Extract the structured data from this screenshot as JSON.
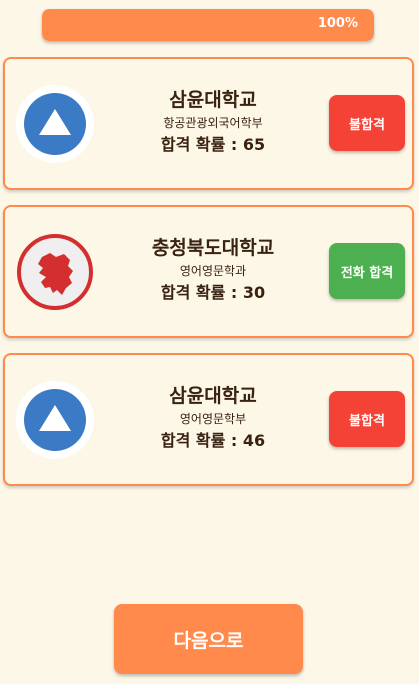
{
  "progress": {
    "value": 1.0,
    "label": "100%"
  },
  "colors": {
    "accent": "#ff8a4c",
    "fail": "#f44336",
    "phone_pass": "#4caf50",
    "background": "#fdf7e8"
  },
  "cards": [
    {
      "name": "삼윤대학교",
      "dept": "항공관광외국어학부",
      "prob": "합격 확률 : 65",
      "status": "불합격",
      "status_color": "#f44336",
      "logo_icon": "triangle-logo-icon"
    },
    {
      "name": "충청북도대학교",
      "dept": "영어영문학과",
      "prob": "합격 확률 : 30",
      "status": "전화 합격",
      "status_color": "#4caf50",
      "logo_icon": "chungbuk-map-logo-icon"
    },
    {
      "name": "삼윤대학교",
      "dept": "영어영문학부",
      "prob": "합격 확률 : 46",
      "status": "불합격",
      "status_color": "#f44336",
      "logo_icon": "triangle-logo-icon"
    }
  ],
  "next_button": {
    "label": "다음으로"
  }
}
